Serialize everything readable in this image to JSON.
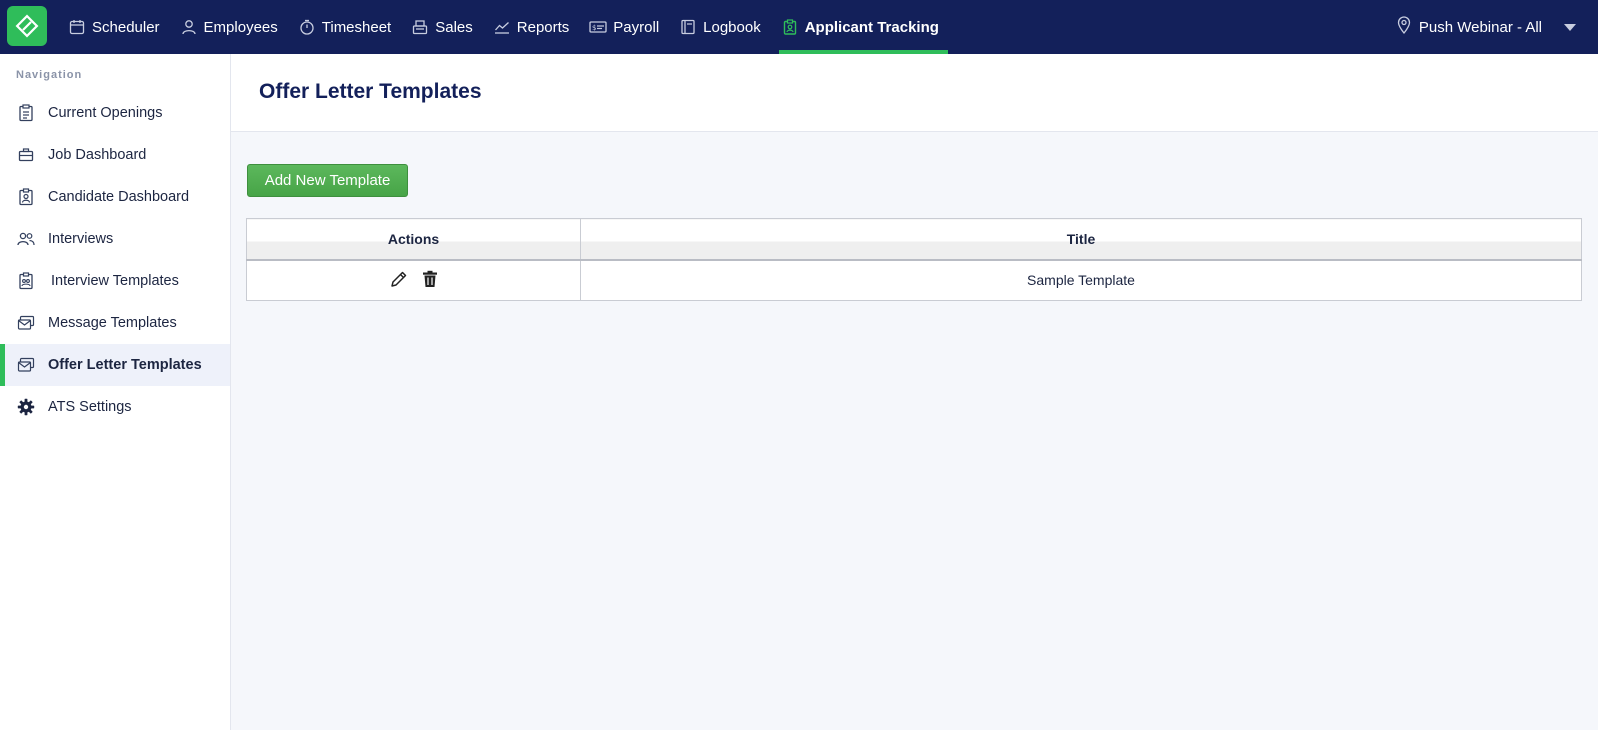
{
  "topnav": {
    "items": [
      {
        "label": "Scheduler",
        "icon": "calendar-icon",
        "active": false
      },
      {
        "label": "Employees",
        "icon": "user-icon",
        "active": false
      },
      {
        "label": "Timesheet",
        "icon": "stopwatch-icon",
        "active": false
      },
      {
        "label": "Sales",
        "icon": "register-icon",
        "active": false
      },
      {
        "label": "Reports",
        "icon": "chart-icon",
        "active": false
      },
      {
        "label": "Payroll",
        "icon": "money-icon",
        "active": false
      },
      {
        "label": "Logbook",
        "icon": "book-icon",
        "active": false
      },
      {
        "label": "Applicant Tracking",
        "icon": "clipboard-icon",
        "active": true
      }
    ],
    "location": "Push Webinar - All"
  },
  "sidebar": {
    "heading": "Navigation",
    "items": [
      {
        "label": "Current Openings",
        "icon": "clipboard-list-icon"
      },
      {
        "label": "Job Dashboard",
        "icon": "briefcase-icon"
      },
      {
        "label": "Candidate Dashboard",
        "icon": "badge-icon"
      },
      {
        "label": "Interviews",
        "icon": "users-icon"
      },
      {
        "label": "Interview Templates",
        "icon": "clipboard-users-icon"
      },
      {
        "label": "Message Templates",
        "icon": "envelope-icon"
      },
      {
        "label": "Offer Letter Templates",
        "icon": "envelope-icon"
      },
      {
        "label": "ATS Settings",
        "icon": "gear-icon"
      }
    ]
  },
  "page": {
    "title": "Offer Letter Templates",
    "add_button": "Add New Template"
  },
  "table": {
    "headers": [
      "Actions",
      "Title"
    ],
    "rows": [
      {
        "title": "Sample Template"
      }
    ]
  },
  "colors": {
    "navy": "#13205a",
    "green": "#2fbd5a"
  }
}
